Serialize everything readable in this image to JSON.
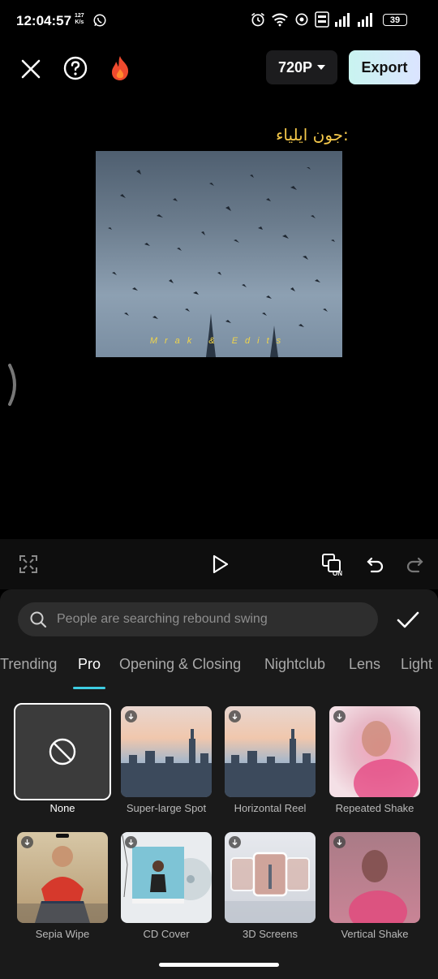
{
  "status": {
    "time": "12:04:57",
    "speed_value": "127",
    "speed_unit": "K/s",
    "battery": "39"
  },
  "toolbar": {
    "resolution": "720P",
    "export_label": "Export"
  },
  "preview": {
    "overlay_text": "جون ایلیاء:",
    "watermark": "Mrak & Edits"
  },
  "search": {
    "placeholder": "People are searching rebound swing"
  },
  "tabs": [
    "Trending",
    "Pro",
    "Opening & Closing",
    "Nightclub",
    "Lens",
    "Light"
  ],
  "active_tab": "Pro",
  "effects": [
    {
      "label": "None",
      "selected": true
    },
    {
      "label": "Super-large Spot"
    },
    {
      "label": "Horizontal Reel"
    },
    {
      "label": "Repeated Shake"
    },
    {
      "label": "Sepia Wipe"
    },
    {
      "label": "CD Cover"
    },
    {
      "label": "3D Screens"
    },
    {
      "label": "Vertical Shake"
    }
  ],
  "colors": {
    "accent": "#3dcde2",
    "export_gradient_start": "#c9f4f0",
    "export_gradient_end": "#dbe4ff",
    "overlay_text": "#f3c74a"
  }
}
